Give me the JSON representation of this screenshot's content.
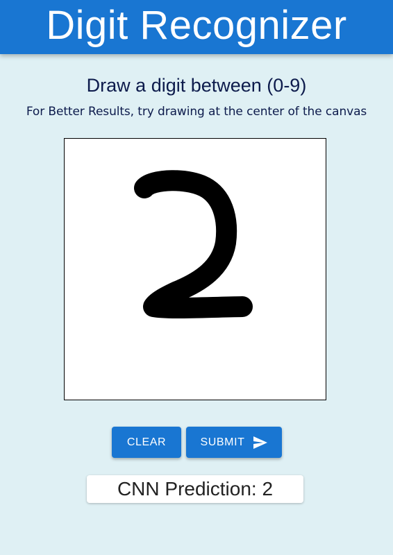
{
  "header": {
    "title": "Digit Recognizer"
  },
  "instructions": {
    "title": "Draw a digit between (0-9)",
    "subtitle": "For Better Results, try drawing at the center of the canvas"
  },
  "canvas": {
    "drawn_digit": "2"
  },
  "actions": {
    "clear_label": "CLEAR",
    "submit_label": "SUBMIT",
    "submit_icon": "send-icon"
  },
  "prediction": {
    "text": "CNN Prediction: 2"
  },
  "colors": {
    "primary": "#1976d2",
    "background": "#dff0f4",
    "text_dark": "#0d1b4c"
  }
}
